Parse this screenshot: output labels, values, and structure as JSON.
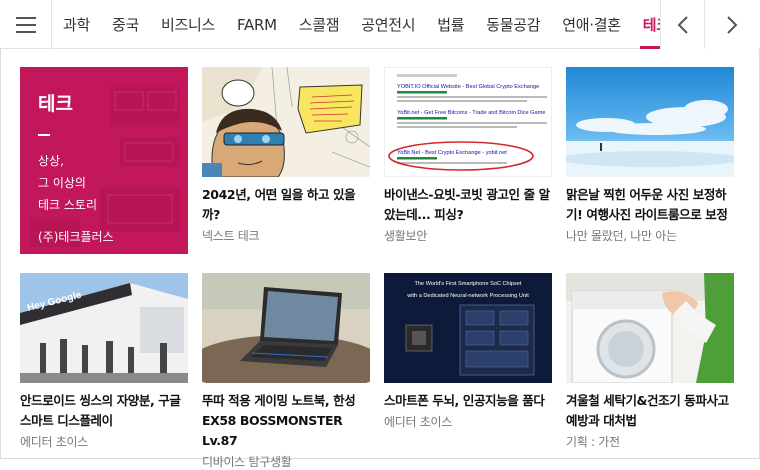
{
  "nav": {
    "tabs": [
      "과학",
      "중국",
      "비즈니스",
      "FARM",
      "스콜잼",
      "공연전시",
      "법률",
      "동물공감",
      "연애·결혼",
      "테크"
    ],
    "active_tab": "테크",
    "accent_color": "#c8155d"
  },
  "promo": {
    "title": "테크",
    "lines": [
      "상상,",
      "그 이상의",
      "테크 스토리"
    ],
    "company": "(주)테크플러스",
    "background_color": "#c2185b"
  },
  "thumb2": {
    "ad_lines": [
      "YOBIT.IO Official Website - Best Global Crypto Exchange",
      "YoBit.net - Get Free Bitcoins - Trade and Bitcoin Dice Game",
      "YoBit.Net - Best Crypto Exchange - yobit.net"
    ]
  },
  "thumb6": {
    "slide_line1": "The World's First Smartphone SoC Chipset",
    "slide_line2": "with a Dedicated Neural-network Processing Unit"
  },
  "cards": [
    {
      "title": "2042년, 어떤 일을 하고 있을까?",
      "source": "넥스트 테크"
    },
    {
      "title": "바이낸스-요빗-코빗 광고인 줄 알았는데... 피싱?",
      "source": "생활보안"
    },
    {
      "title": "맑은날 찍힌 어두운 사진 보정하기! 여행사진 라이트룸으로 보정",
      "source": "나만 몰랐던, 나만 아는"
    },
    {
      "title": "안드로이드 씽스의 자양분, 구글 스마트 디스플레이",
      "source": "에디터 초이스"
    },
    {
      "title": "뚜따 적용 게이밍 노트북, 한성 EX58 BOSSMONSTER Lv.87",
      "source": "디바이스 탐구생활"
    },
    {
      "title": "스마트폰 두뇌, 인공지능을 품다",
      "source": "에디터 초이스"
    },
    {
      "title": "겨울철 세탁기&건조기 동파사고 예방과 대처법",
      "source": "기획 : 가전"
    }
  ]
}
